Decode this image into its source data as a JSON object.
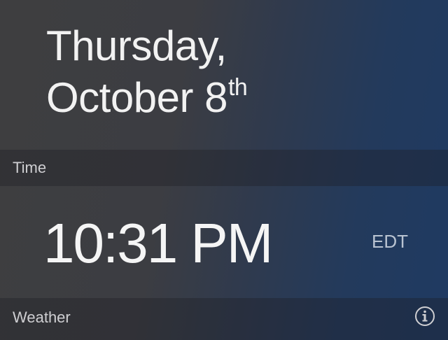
{
  "date": {
    "weekday": "Thursday,",
    "month_day": "October 8",
    "ordinal_suffix": "th"
  },
  "sections": {
    "time": {
      "title": "Time",
      "clock": "10:31 PM",
      "timezone": "EDT"
    },
    "weather": {
      "title": "Weather",
      "info_icon": "info-circle-icon"
    }
  },
  "colors": {
    "background_left": "#3e3e40",
    "background_right": "#1f3a62",
    "header_text": "#cfcfd2",
    "timezone_text": "#b9c3d1"
  }
}
